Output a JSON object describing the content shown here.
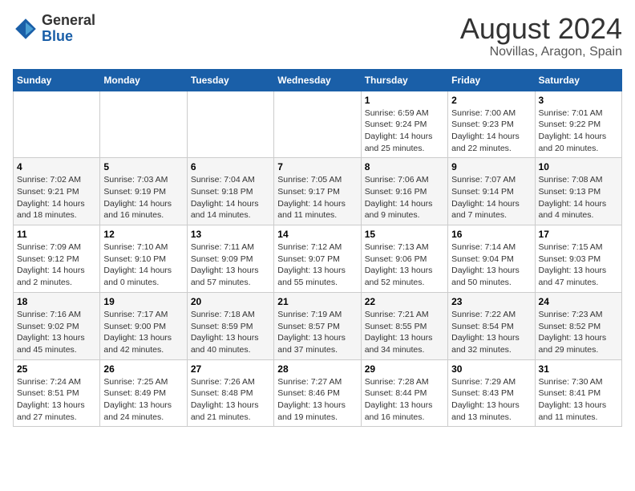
{
  "logo": {
    "general": "General",
    "blue": "Blue"
  },
  "header": {
    "title": "August 2024",
    "subtitle": "Novillas, Aragon, Spain"
  },
  "weekdays": [
    "Sunday",
    "Monday",
    "Tuesday",
    "Wednesday",
    "Thursday",
    "Friday",
    "Saturday"
  ],
  "weeks": [
    [
      {
        "day": "",
        "info": ""
      },
      {
        "day": "",
        "info": ""
      },
      {
        "day": "",
        "info": ""
      },
      {
        "day": "",
        "info": ""
      },
      {
        "day": "1",
        "info": "Sunrise: 6:59 AM\nSunset: 9:24 PM\nDaylight: 14 hours\nand 25 minutes."
      },
      {
        "day": "2",
        "info": "Sunrise: 7:00 AM\nSunset: 9:23 PM\nDaylight: 14 hours\nand 22 minutes."
      },
      {
        "day": "3",
        "info": "Sunrise: 7:01 AM\nSunset: 9:22 PM\nDaylight: 14 hours\nand 20 minutes."
      }
    ],
    [
      {
        "day": "4",
        "info": "Sunrise: 7:02 AM\nSunset: 9:21 PM\nDaylight: 14 hours\nand 18 minutes."
      },
      {
        "day": "5",
        "info": "Sunrise: 7:03 AM\nSunset: 9:19 PM\nDaylight: 14 hours\nand 16 minutes."
      },
      {
        "day": "6",
        "info": "Sunrise: 7:04 AM\nSunset: 9:18 PM\nDaylight: 14 hours\nand 14 minutes."
      },
      {
        "day": "7",
        "info": "Sunrise: 7:05 AM\nSunset: 9:17 PM\nDaylight: 14 hours\nand 11 minutes."
      },
      {
        "day": "8",
        "info": "Sunrise: 7:06 AM\nSunset: 9:16 PM\nDaylight: 14 hours\nand 9 minutes."
      },
      {
        "day": "9",
        "info": "Sunrise: 7:07 AM\nSunset: 9:14 PM\nDaylight: 14 hours\nand 7 minutes."
      },
      {
        "day": "10",
        "info": "Sunrise: 7:08 AM\nSunset: 9:13 PM\nDaylight: 14 hours\nand 4 minutes."
      }
    ],
    [
      {
        "day": "11",
        "info": "Sunrise: 7:09 AM\nSunset: 9:12 PM\nDaylight: 14 hours\nand 2 minutes."
      },
      {
        "day": "12",
        "info": "Sunrise: 7:10 AM\nSunset: 9:10 PM\nDaylight: 14 hours\nand 0 minutes."
      },
      {
        "day": "13",
        "info": "Sunrise: 7:11 AM\nSunset: 9:09 PM\nDaylight: 13 hours\nand 57 minutes."
      },
      {
        "day": "14",
        "info": "Sunrise: 7:12 AM\nSunset: 9:07 PM\nDaylight: 13 hours\nand 55 minutes."
      },
      {
        "day": "15",
        "info": "Sunrise: 7:13 AM\nSunset: 9:06 PM\nDaylight: 13 hours\nand 52 minutes."
      },
      {
        "day": "16",
        "info": "Sunrise: 7:14 AM\nSunset: 9:04 PM\nDaylight: 13 hours\nand 50 minutes."
      },
      {
        "day": "17",
        "info": "Sunrise: 7:15 AM\nSunset: 9:03 PM\nDaylight: 13 hours\nand 47 minutes."
      }
    ],
    [
      {
        "day": "18",
        "info": "Sunrise: 7:16 AM\nSunset: 9:02 PM\nDaylight: 13 hours\nand 45 minutes."
      },
      {
        "day": "19",
        "info": "Sunrise: 7:17 AM\nSunset: 9:00 PM\nDaylight: 13 hours\nand 42 minutes."
      },
      {
        "day": "20",
        "info": "Sunrise: 7:18 AM\nSunset: 8:59 PM\nDaylight: 13 hours\nand 40 minutes."
      },
      {
        "day": "21",
        "info": "Sunrise: 7:19 AM\nSunset: 8:57 PM\nDaylight: 13 hours\nand 37 minutes."
      },
      {
        "day": "22",
        "info": "Sunrise: 7:21 AM\nSunset: 8:55 PM\nDaylight: 13 hours\nand 34 minutes."
      },
      {
        "day": "23",
        "info": "Sunrise: 7:22 AM\nSunset: 8:54 PM\nDaylight: 13 hours\nand 32 minutes."
      },
      {
        "day": "24",
        "info": "Sunrise: 7:23 AM\nSunset: 8:52 PM\nDaylight: 13 hours\nand 29 minutes."
      }
    ],
    [
      {
        "day": "25",
        "info": "Sunrise: 7:24 AM\nSunset: 8:51 PM\nDaylight: 13 hours\nand 27 minutes."
      },
      {
        "day": "26",
        "info": "Sunrise: 7:25 AM\nSunset: 8:49 PM\nDaylight: 13 hours\nand 24 minutes."
      },
      {
        "day": "27",
        "info": "Sunrise: 7:26 AM\nSunset: 8:48 PM\nDaylight: 13 hours\nand 21 minutes."
      },
      {
        "day": "28",
        "info": "Sunrise: 7:27 AM\nSunset: 8:46 PM\nDaylight: 13 hours\nand 19 minutes."
      },
      {
        "day": "29",
        "info": "Sunrise: 7:28 AM\nSunset: 8:44 PM\nDaylight: 13 hours\nand 16 minutes."
      },
      {
        "day": "30",
        "info": "Sunrise: 7:29 AM\nSunset: 8:43 PM\nDaylight: 13 hours\nand 13 minutes."
      },
      {
        "day": "31",
        "info": "Sunrise: 7:30 AM\nSunset: 8:41 PM\nDaylight: 13 hours\nand 11 minutes."
      }
    ]
  ]
}
